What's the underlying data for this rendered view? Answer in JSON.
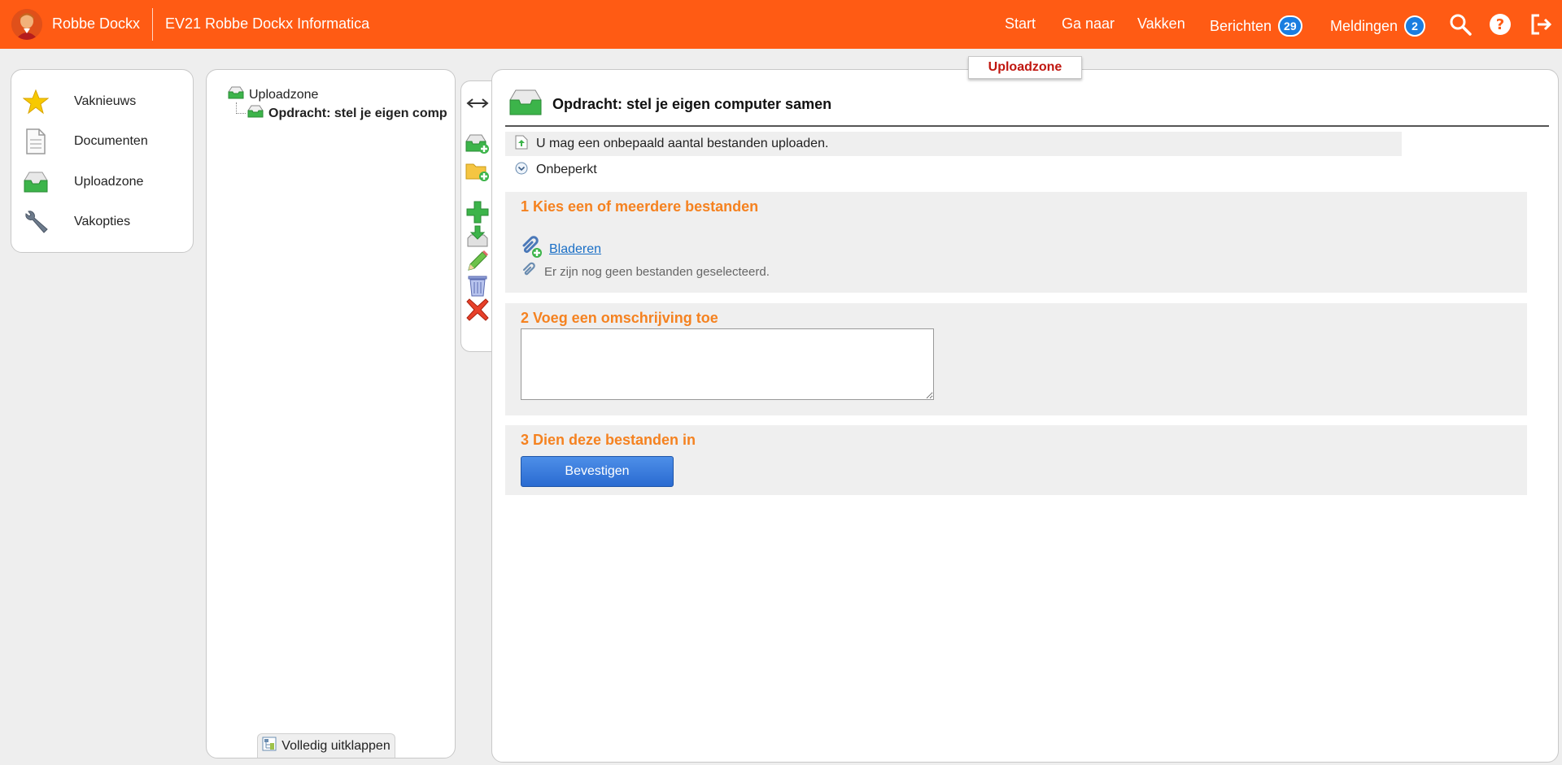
{
  "header": {
    "user_name": "Robbe Dockx",
    "course_title": "EV21 Robbe Dockx Informatica",
    "nav": {
      "start": "Start",
      "goto": "Ga naar",
      "courses": "Vakken",
      "messages": "Berichten",
      "messages_count": "29",
      "notifications": "Meldingen",
      "notifications_count": "2"
    },
    "icons": [
      "search-icon",
      "help-icon",
      "logout-icon"
    ],
    "accent_color": "#ff5b14",
    "badge_color": "#1a7de0"
  },
  "sidebar": {
    "items": [
      {
        "label": "Vaknieuws",
        "icon": "star-icon"
      },
      {
        "label": "Documenten",
        "icon": "document-icon"
      },
      {
        "label": "Uploadzone",
        "icon": "inbox-icon"
      },
      {
        "label": "Vakopties",
        "icon": "wrench-icon"
      }
    ]
  },
  "tree": {
    "root": "Uploadzone",
    "child": "Opdracht: stel je eigen comp",
    "expand_label": "Volledig uitklappen"
  },
  "toolbar": {
    "tools": [
      "resize-icon",
      "add-uploadzone-icon",
      "add-folder-icon",
      "add-icon",
      "download-icon",
      "edit-icon",
      "trash-icon",
      "delete-icon"
    ]
  },
  "main": {
    "tab_label": "Uploadzone",
    "title": "Opdracht: stel je eigen computer samen",
    "info_text": "U mag een onbepaald aantal bestanden uploaden.",
    "limit_text": "Onbeperkt",
    "step1": {
      "title": "1 Kies een of meerdere bestanden",
      "browse_label": "Bladeren",
      "no_files_text": "Er zijn nog geen bestanden geselecteerd."
    },
    "step2": {
      "title": "2 Voeg een omschrijving toe",
      "description_value": ""
    },
    "step3": {
      "title": "3 Dien deze bestanden in",
      "confirm_label": "Bevestigen"
    },
    "title_accent": "#f58220",
    "tab_text_color": "#c0160f"
  }
}
